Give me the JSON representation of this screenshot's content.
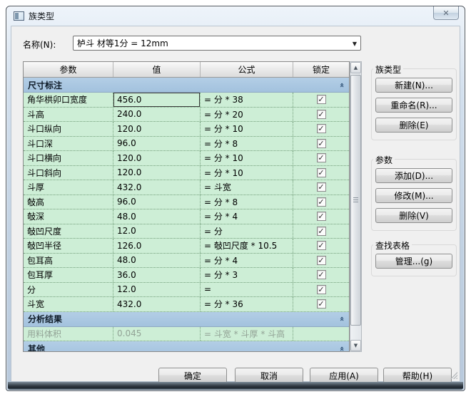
{
  "window": {
    "title": "族类型"
  },
  "icons": {
    "close": "✕",
    "dropdown": "▼",
    "collapse": "«",
    "scroll_up": "▲",
    "scroll_down": "▼",
    "check": "✓"
  },
  "name_row": {
    "label": "名称(N):",
    "value": "栌斗 材等1分 = 12mm"
  },
  "table": {
    "headers": [
      "参数",
      "值",
      "公式",
      "锁定"
    ],
    "rows": [
      {
        "type": "section",
        "label": "尺寸标注"
      },
      {
        "type": "param",
        "name": "角华栱卯口宽度",
        "value": "456.0",
        "formula": "= 分 * 38",
        "locked": true,
        "focused": true
      },
      {
        "type": "param",
        "name": "斗高",
        "value": "240.0",
        "formula": "= 分 * 20",
        "locked": true
      },
      {
        "type": "param",
        "name": "斗口纵向",
        "value": "120.0",
        "formula": "= 分 * 10",
        "locked": true
      },
      {
        "type": "param",
        "name": "斗口深",
        "value": "96.0",
        "formula": "= 分 * 8",
        "locked": true
      },
      {
        "type": "param",
        "name": "斗口横向",
        "value": "120.0",
        "formula": "= 分 * 10",
        "locked": true
      },
      {
        "type": "param",
        "name": "斗口斜向",
        "value": "120.0",
        "formula": "= 分 * 10",
        "locked": true
      },
      {
        "type": "param",
        "name": "斗厚",
        "value": "432.0",
        "formula": "= 斗宽",
        "locked": true
      },
      {
        "type": "param",
        "name": "敧高",
        "value": "96.0",
        "formula": "= 分 * 8",
        "locked": true
      },
      {
        "type": "param",
        "name": "敧深",
        "value": "48.0",
        "formula": "= 分 * 4",
        "locked": true
      },
      {
        "type": "param",
        "name": "敧凹尺度",
        "value": "12.0",
        "formula": "= 分",
        "locked": true
      },
      {
        "type": "param",
        "name": "敧凹半径",
        "value": "126.0",
        "formula": "= 敧凹尺度 * 10.5",
        "locked": true
      },
      {
        "type": "param",
        "name": "包耳高",
        "value": "48.0",
        "formula": "= 分 * 4",
        "locked": true
      },
      {
        "type": "param",
        "name": "包耳厚",
        "value": "36.0",
        "formula": "= 分 * 3",
        "locked": true
      },
      {
        "type": "param",
        "name": "分",
        "value": "12.0",
        "formula": "=",
        "locked": true
      },
      {
        "type": "param",
        "name": "斗宽",
        "value": "432.0",
        "formula": "= 分 * 36",
        "locked": true
      },
      {
        "type": "section",
        "label": "分析结果"
      },
      {
        "type": "param",
        "name": "用料体积",
        "value": "0.045",
        "formula": "= 斗宽 * 斗厚 * 斗高",
        "locked": null,
        "disabled": true
      },
      {
        "type": "section",
        "label": "其他"
      }
    ]
  },
  "side_panel": {
    "groups": [
      {
        "label": "族类型",
        "buttons": [
          "新建(N)...",
          "重命名(R)...",
          "删除(E)"
        ]
      },
      {
        "label": "参数",
        "buttons": [
          "添加(D)...",
          "修改(M)...",
          "删除(V)"
        ]
      },
      {
        "label": "查找表格",
        "buttons": [
          "管理...(g)"
        ]
      }
    ]
  },
  "footer": {
    "buttons": [
      "确定",
      "取消",
      "应用(A)",
      "帮助(H)"
    ]
  },
  "colors": {
    "row_green": "#cdeed6",
    "section_blue": "#a3c2de",
    "dialog_bg": "#f0f0f0",
    "grid_dot_green": "#74a07c"
  }
}
